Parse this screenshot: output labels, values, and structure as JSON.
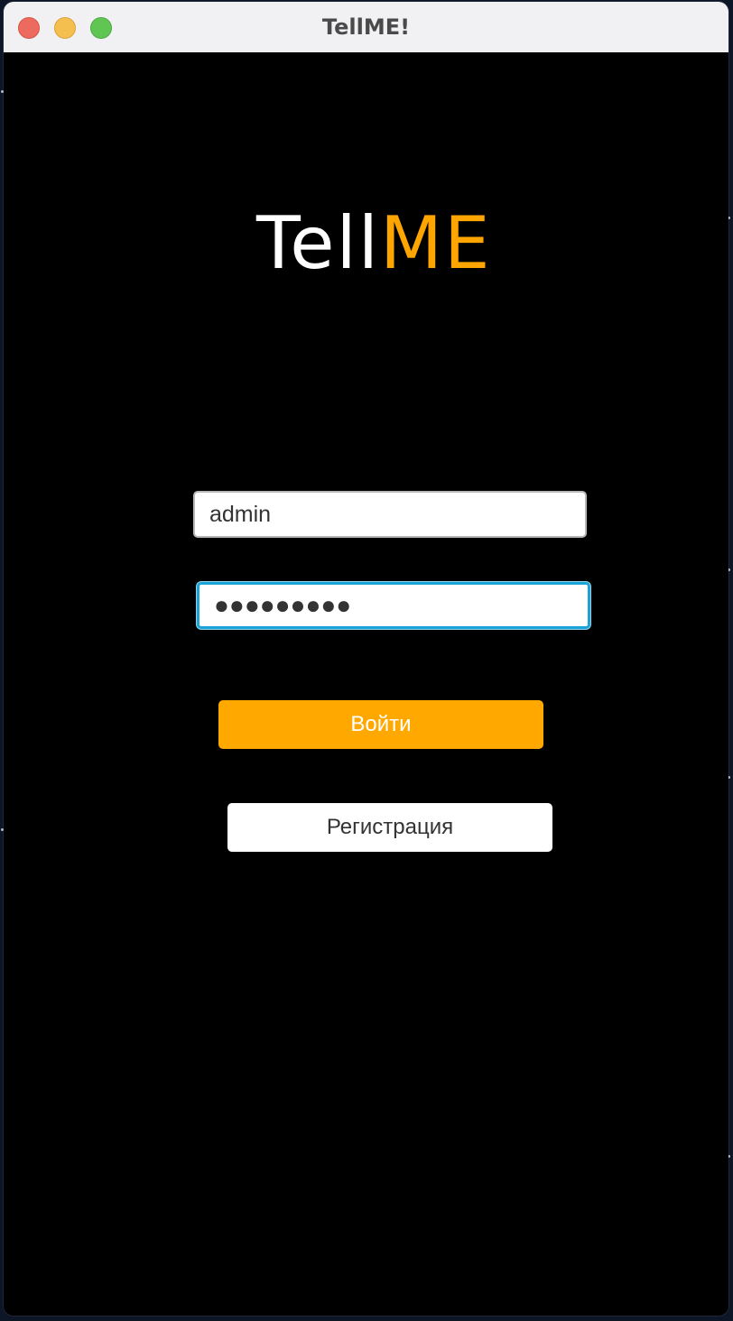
{
  "window": {
    "title": "TellME!"
  },
  "logo": {
    "part_a": "Tell",
    "part_b": "ME"
  },
  "login_form": {
    "username_value": "admin",
    "password_masked": "●●●●●●●●●",
    "login_button_label": "Войти",
    "register_button_label": "Регистрация"
  },
  "colors": {
    "accent": "#ffa800",
    "focus_ring": "#1aa3d6",
    "background": "#000000"
  }
}
